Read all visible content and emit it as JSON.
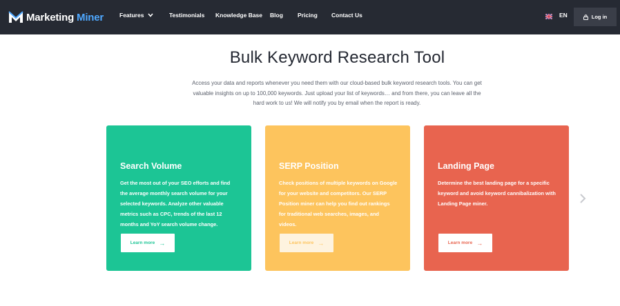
{
  "brand": {
    "name_part1": "Marketing",
    "name_part2": "Miner",
    "accent_color": "#4fa8ff"
  },
  "nav": {
    "features": "Features",
    "testimonials": "Testimonials",
    "knowledge_base": "Knowledge Base",
    "blog": "Blog",
    "pricing": "Pricing",
    "contact": "Contact Us",
    "language": "EN",
    "login": "Log in"
  },
  "hero": {
    "title": "Bulk Keyword Research Tool",
    "intro": "Access your data and reports whenever you need them with our cloud-based bulk keyword research tools. You can get valuable insights on up to 100,000 keywords. Just upload your list of keywords… and from there, you can leave all the hard work to us! We will notify you by email when the report is ready."
  },
  "cards": [
    {
      "title": "Search Volume",
      "description": "Get the most out of your SEO efforts and find the average monthly search volume for your selected keywords. Analyze other valuable metrics such as CPC, trends of the last 12 months and YoY search volume change.",
      "button": "Learn more",
      "color": "#1cc595"
    },
    {
      "title": "SERP Position",
      "description": "Check positions of multiple keywords on Google for your website and competitors. Our SERP Position miner can help you find out rankings for traditional web searches, images, and videos.",
      "button": "Learn more",
      "color": "#fdc45d"
    },
    {
      "title": "Landing Page",
      "description": "Determine the best landing page for a specific keyword and avoid keyword cannibalization with Landing Page miner.",
      "button": "Learn more",
      "color": "#e8644f"
    }
  ],
  "icons": {
    "logo": "marketing-miner-logo-icon",
    "chevron": "chevron-down-icon",
    "flag": "uk-flag-icon",
    "lock": "lock-icon",
    "arrow": "arrow-right-icon",
    "next": "chevron-right-icon"
  }
}
